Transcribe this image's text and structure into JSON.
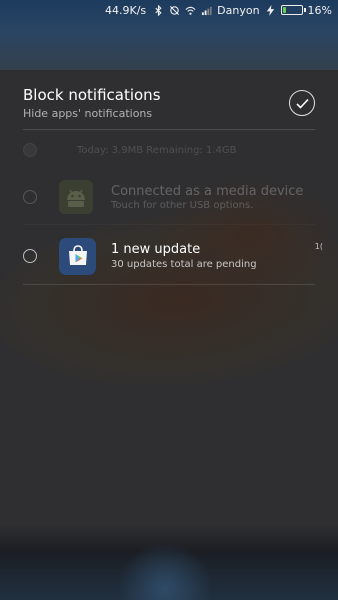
{
  "status_bar": {
    "net_speed": "44.9K/s",
    "carrier": "Danyon",
    "battery_percent": "16%",
    "battery_level": 0.16,
    "icons": [
      "bluetooth-icon",
      "sync-off-icon",
      "wifi-icon",
      "signal-icon",
      "charging-icon",
      "battery-icon"
    ]
  },
  "header": {
    "title": "Block notifications",
    "subtitle": "Hide apps' notifications",
    "confirm_icon": "check-icon"
  },
  "notifications": [
    {
      "text": "Today: 3.9MB   Remaining: 1.4GB",
      "faded": true
    },
    {
      "title": "Connected as a media device",
      "subtitle": "Touch for other USB options.",
      "icon": "android-icon",
      "faded": true
    },
    {
      "title": "1 new update",
      "subtitle": "30 updates total are pending",
      "icon": "play-store-icon",
      "time": "1(",
      "faded": false
    }
  ],
  "colors": {
    "accent_check": "#ffffff",
    "battery_fill": "#6ad04b",
    "play_store_bg": "#2c4a7a"
  }
}
